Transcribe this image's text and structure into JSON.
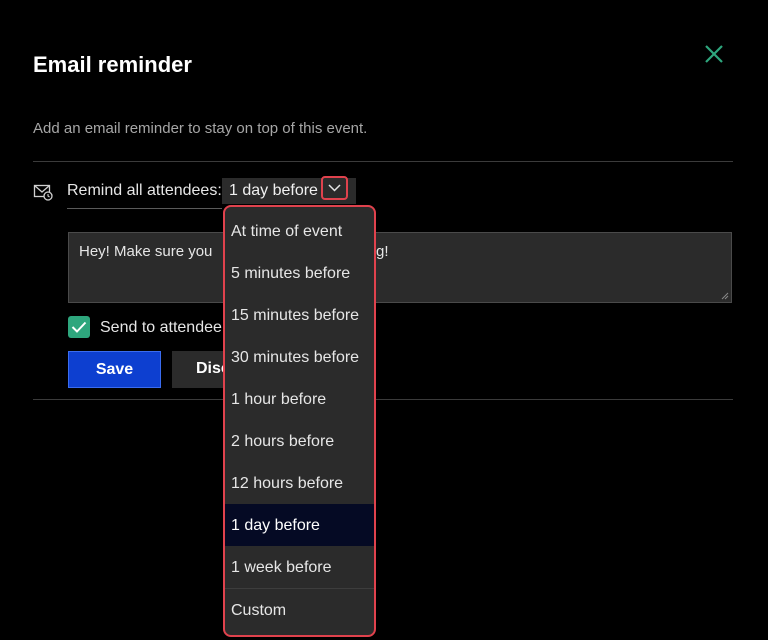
{
  "dialog": {
    "title": "Email reminder",
    "subtitle": "Add an email reminder to stay on top of this event.",
    "close_icon": "close-x-icon",
    "accent_color": "#2ea67d"
  },
  "reminder": {
    "label": "Remind all attendees:",
    "selected_value": "1 day before",
    "icon": "envelope-clock-icon"
  },
  "message": {
    "visible_start": "Hey! Make sure you",
    "visible_end": "g!"
  },
  "send_option": {
    "checked": true,
    "label": "Send to attendee"
  },
  "buttons": {
    "save": "Save",
    "discard": "Disc"
  },
  "dropdown": {
    "highlight_color": "#e0424d",
    "options": [
      "At time of event",
      "5 minutes before",
      "15 minutes before",
      "30 minutes before",
      "1 hour before",
      "2 hours before",
      "12 hours before",
      "1 day before",
      "1 week before",
      "Custom"
    ],
    "selected_index": 7
  }
}
